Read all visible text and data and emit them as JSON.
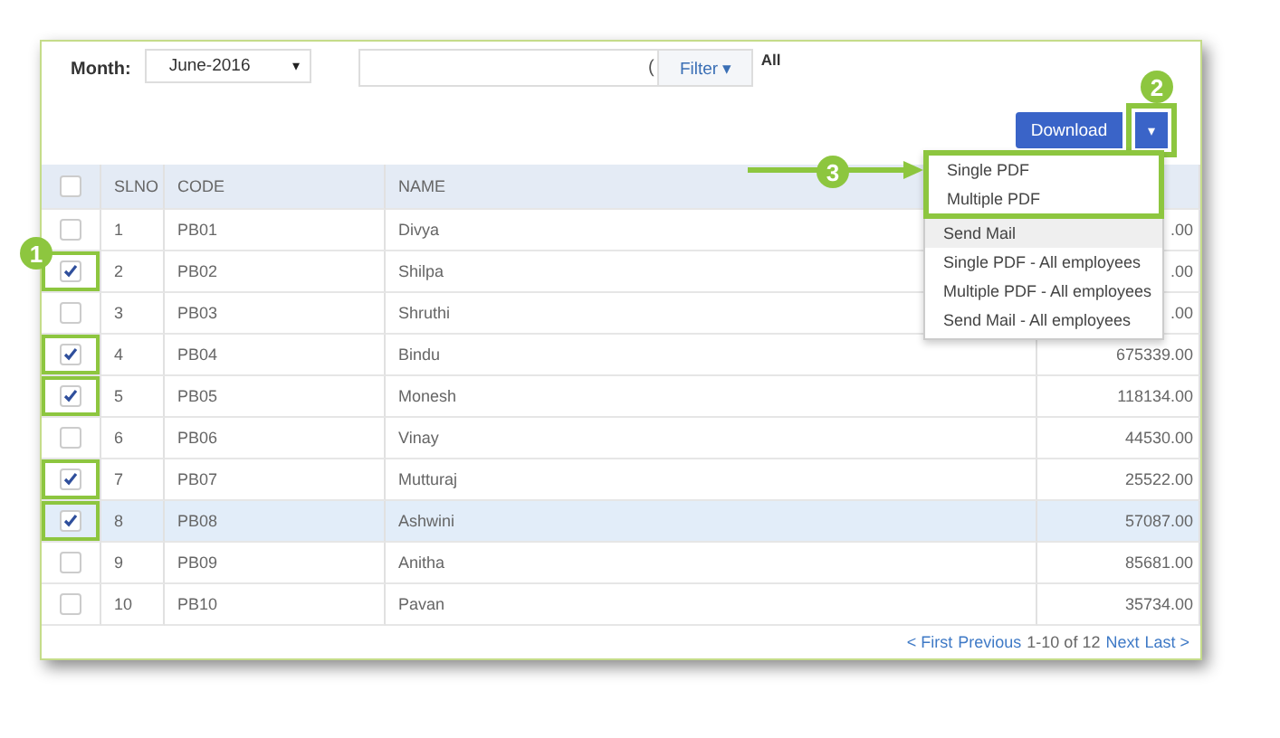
{
  "toolbar": {
    "month_label": "Month:",
    "month_value": "June-2016",
    "month_caret": "▾",
    "search": {
      "icon_char": "(",
      "filter_button": "Filter ▾"
    },
    "filter_value": "All"
  },
  "download": {
    "label": "Download",
    "caret": "▾",
    "annotated": true
  },
  "dropdown": [
    {
      "label": "Single PDF",
      "highlighted": false,
      "annotated": true
    },
    {
      "label": "Multiple PDF",
      "highlighted": false,
      "annotated": true
    },
    {
      "label": "Send Mail",
      "highlighted": true,
      "annotated": false
    },
    {
      "label": "Single PDF - All employees",
      "highlighted": false,
      "annotated": false
    },
    {
      "label": "Multiple PDF - All employees",
      "highlighted": false,
      "annotated": false
    },
    {
      "label": "Send Mail - All employees",
      "highlighted": false,
      "annotated": false
    }
  ],
  "table": {
    "select_all_checked": false,
    "columns": [
      "SLNO",
      "CODE",
      "NAME"
    ],
    "rows": [
      {
        "checked": false,
        "highlighted": false,
        "cells": [
          "1",
          "PB01",
          "Divya",
          ".00"
        ]
      },
      {
        "checked": true,
        "highlighted": false,
        "cells": [
          "2",
          "PB02",
          "Shilpa",
          ".00"
        ]
      },
      {
        "checked": false,
        "highlighted": false,
        "cells": [
          "3",
          "PB03",
          "Shruthi",
          ".00"
        ]
      },
      {
        "checked": true,
        "highlighted": false,
        "cells": [
          "4",
          "PB04",
          "Bindu",
          "675339.00"
        ]
      },
      {
        "checked": true,
        "highlighted": false,
        "cells": [
          "5",
          "PB05",
          "Monesh",
          "118134.00"
        ]
      },
      {
        "checked": false,
        "highlighted": false,
        "cells": [
          "6",
          "PB06",
          "Vinay",
          "44530.00"
        ]
      },
      {
        "checked": true,
        "highlighted": false,
        "cells": [
          "7",
          "PB07",
          "Mutturaj",
          "25522.00"
        ]
      },
      {
        "checked": true,
        "highlighted": true,
        "cells": [
          "8",
          "PB08",
          "Ashwini",
          "57087.00"
        ]
      },
      {
        "checked": false,
        "highlighted": false,
        "cells": [
          "9",
          "PB09",
          "Anitha",
          "85681.00"
        ]
      },
      {
        "checked": false,
        "highlighted": false,
        "cells": [
          "10",
          "PB10",
          "Pavan",
          "35734.00"
        ]
      }
    ]
  },
  "pagination": {
    "first": "< First",
    "previous": "Previous",
    "range": "1-10 of 12",
    "next": "Next",
    "last": "Last >"
  },
  "callouts": [
    {
      "label": "1"
    },
    {
      "label": "2"
    },
    {
      "label": "3"
    }
  ]
}
